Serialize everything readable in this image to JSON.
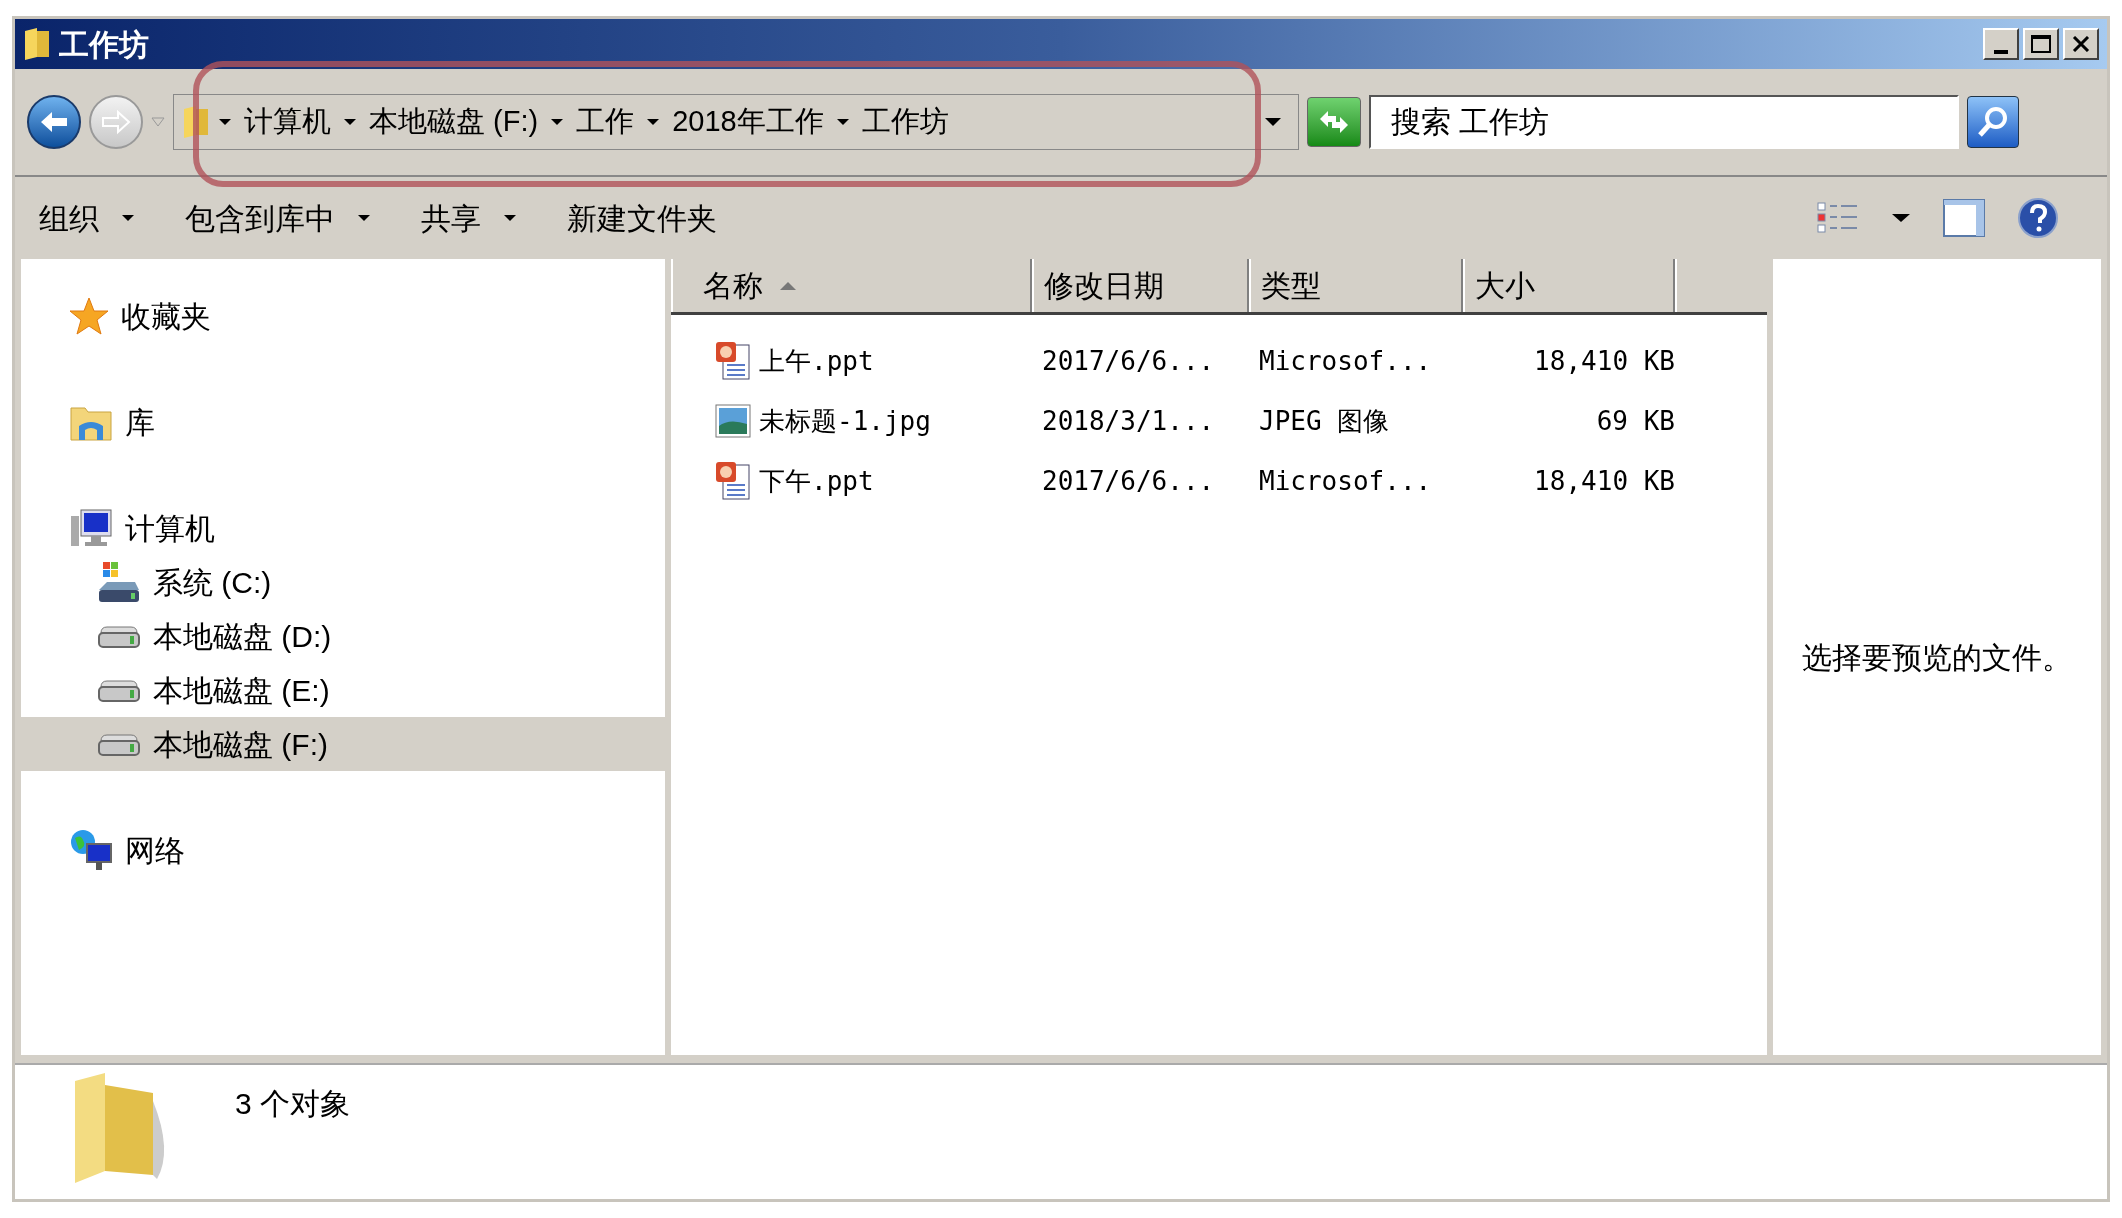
{
  "window": {
    "title": "工作坊"
  },
  "address": {
    "breadcrumbs": [
      "计算机",
      "本地磁盘 (F:)",
      "工作",
      "2018年工作",
      "工作坊"
    ]
  },
  "search": {
    "placeholder": "搜索 工作坊"
  },
  "toolbar": [
    {
      "label": "组织",
      "dropdown": true
    },
    {
      "label": "包含到库中",
      "dropdown": true
    },
    {
      "label": "共享",
      "dropdown": true
    },
    {
      "label": "新建文件夹",
      "dropdown": false
    }
  ],
  "sidebar": {
    "items": [
      {
        "label": "收藏夹",
        "kind": "favorites",
        "selected": false
      },
      {
        "label": "库",
        "kind": "library",
        "selected": false
      },
      {
        "label": "计算机",
        "kind": "computer",
        "selected": false,
        "children": [
          {
            "label": "系统 (C:)",
            "kind": "system-drive",
            "selected": false
          },
          {
            "label": "本地磁盘 (D:)",
            "kind": "drive",
            "selected": false
          },
          {
            "label": "本地磁盘 (E:)",
            "kind": "drive",
            "selected": false
          },
          {
            "label": "本地磁盘 (F:)",
            "kind": "drive",
            "selected": true
          }
        ]
      },
      {
        "label": "网络",
        "kind": "network",
        "selected": false
      }
    ]
  },
  "table": {
    "columns": [
      {
        "label": "名称",
        "sorted": true
      },
      {
        "label": "修改日期",
        "sorted": false
      },
      {
        "label": "类型",
        "sorted": false
      },
      {
        "label": "大小",
        "sorted": false
      }
    ],
    "rows": [
      {
        "kind": "presentation",
        "name": "上午.ppt",
        "date": "2017/6/6...",
        "type": "Microsof...",
        "size": "18,410 KB"
      },
      {
        "kind": "image",
        "name": "未标题-1.jpg",
        "date": "2018/3/1...",
        "type": "JPEG 图像",
        "size": "69 KB"
      },
      {
        "kind": "presentation",
        "name": "下午.ppt",
        "date": "2017/6/6...",
        "type": "Microsof...",
        "size": "18,410 KB"
      }
    ]
  },
  "preview": {
    "message": "选择要预览的文件。"
  },
  "status_bar": {
    "text": "3 个对象"
  }
}
